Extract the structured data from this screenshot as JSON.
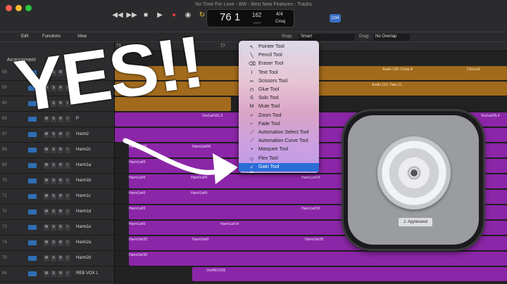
{
  "window": {
    "title": "No Time For Love - BW - Best New Features - Tracks"
  },
  "lcd": {
    "bar": "76 1",
    "tempo": "162",
    "tempo_label": "KEEP",
    "time_signature": "4/4",
    "key": "Cmaj"
  },
  "header_badge": "1234",
  "toolbar": {
    "edit": "Edit",
    "functions": "Functions",
    "view": "View",
    "snap_label": "Snap:",
    "snap_value": "Smart",
    "drag_label": "Drag:",
    "drag_value": "No Overlap"
  },
  "track_header": {
    "arrangement_label": "Arrangement"
  },
  "ruler": {
    "bars": [
      "73",
      "77"
    ]
  },
  "tracks": [
    {
      "num": "58",
      "name": ""
    },
    {
      "num": "59",
      "name": "D"
    },
    {
      "num": "60",
      "name": ""
    },
    {
      "num": "66",
      "name": "P"
    },
    {
      "num": "67",
      "name": "Harm2"
    },
    {
      "num": "68",
      "name": "Harm2c"
    },
    {
      "num": "69",
      "name": "Harm1a"
    },
    {
      "num": "70",
      "name": "Harm1b"
    },
    {
      "num": "71",
      "name": "Harm1c"
    },
    {
      "num": "72",
      "name": "Harm1d"
    },
    {
      "num": "73",
      "name": "Harm1e"
    },
    {
      "num": "74",
      "name": "Harm2a"
    },
    {
      "num": "75",
      "name": "Harm2d"
    },
    {
      "num": "84",
      "name": "REB VOX L"
    }
  ],
  "track_buttons": {
    "m": "M",
    "s": "S",
    "r": "R",
    "i": "I"
  },
  "regions": {
    "audio130": "Audio 130: Comp A",
    "audio131": "Audio 131: Take 11",
    "chorus": "Chorus3",
    "vox101": "Vox1a#101.3",
    "vox35": "Vox1a#35.4",
    "harm31": "Harm2a#31",
    "harm06": "Harm2a#06",
    "harm1a0": "Harm1a#0",
    "harm1a24": "Harm1a#24",
    "harm14": "Harm1a#14",
    "harm19": "Harm1a#19",
    "harm33": "Harm2a#33",
    "harm30": "Harm2a#30",
    "harm28": "Harm2a#28",
    "voxrec": "VoxREC#35",
    "harm2a0": "Harm2a#0"
  },
  "tool_menu": {
    "items": [
      {
        "icon": "↖",
        "label": "Pointer Tool",
        "selected": false
      },
      {
        "icon": "╲",
        "label": "Pencil Tool",
        "selected": false
      },
      {
        "icon": "⌫",
        "label": "Eraser Tool",
        "selected": false
      },
      {
        "icon": "I",
        "label": "Text Tool",
        "selected": false
      },
      {
        "icon": "✂",
        "label": "Scissors Tool",
        "selected": false
      },
      {
        "icon": "⊓",
        "label": "Glue Tool",
        "selected": false
      },
      {
        "icon": "S",
        "label": "Solo Tool",
        "selected": false
      },
      {
        "icon": "M",
        "label": "Mute Tool",
        "selected": false
      },
      {
        "icon": "⌕",
        "label": "Zoom Tool",
        "selected": false
      },
      {
        "icon": "⌐",
        "label": "Fade Tool",
        "selected": false
      },
      {
        "icon": "⟋",
        "label": "Automation Select Tool",
        "selected": false
      },
      {
        "icon": "⟋",
        "label": "Automation Curve Tool",
        "selected": false
      },
      {
        "icon": "+",
        "label": "Marquee Tool",
        "selected": false
      },
      {
        "icon": "◇",
        "label": "Flex Tool",
        "selected": false
      },
      {
        "icon": "✓ ◂|▸",
        "label": "Gain Tool",
        "selected": true
      }
    ]
  },
  "overlay": {
    "yes_text": "YES!!"
  },
  "logo": {
    "name_badge": "J. Appleseed"
  },
  "colors": {
    "region_purple": "#8c26a8",
    "region_orange": "#a26a1c",
    "menu_selected": "#2b6dd6"
  }
}
